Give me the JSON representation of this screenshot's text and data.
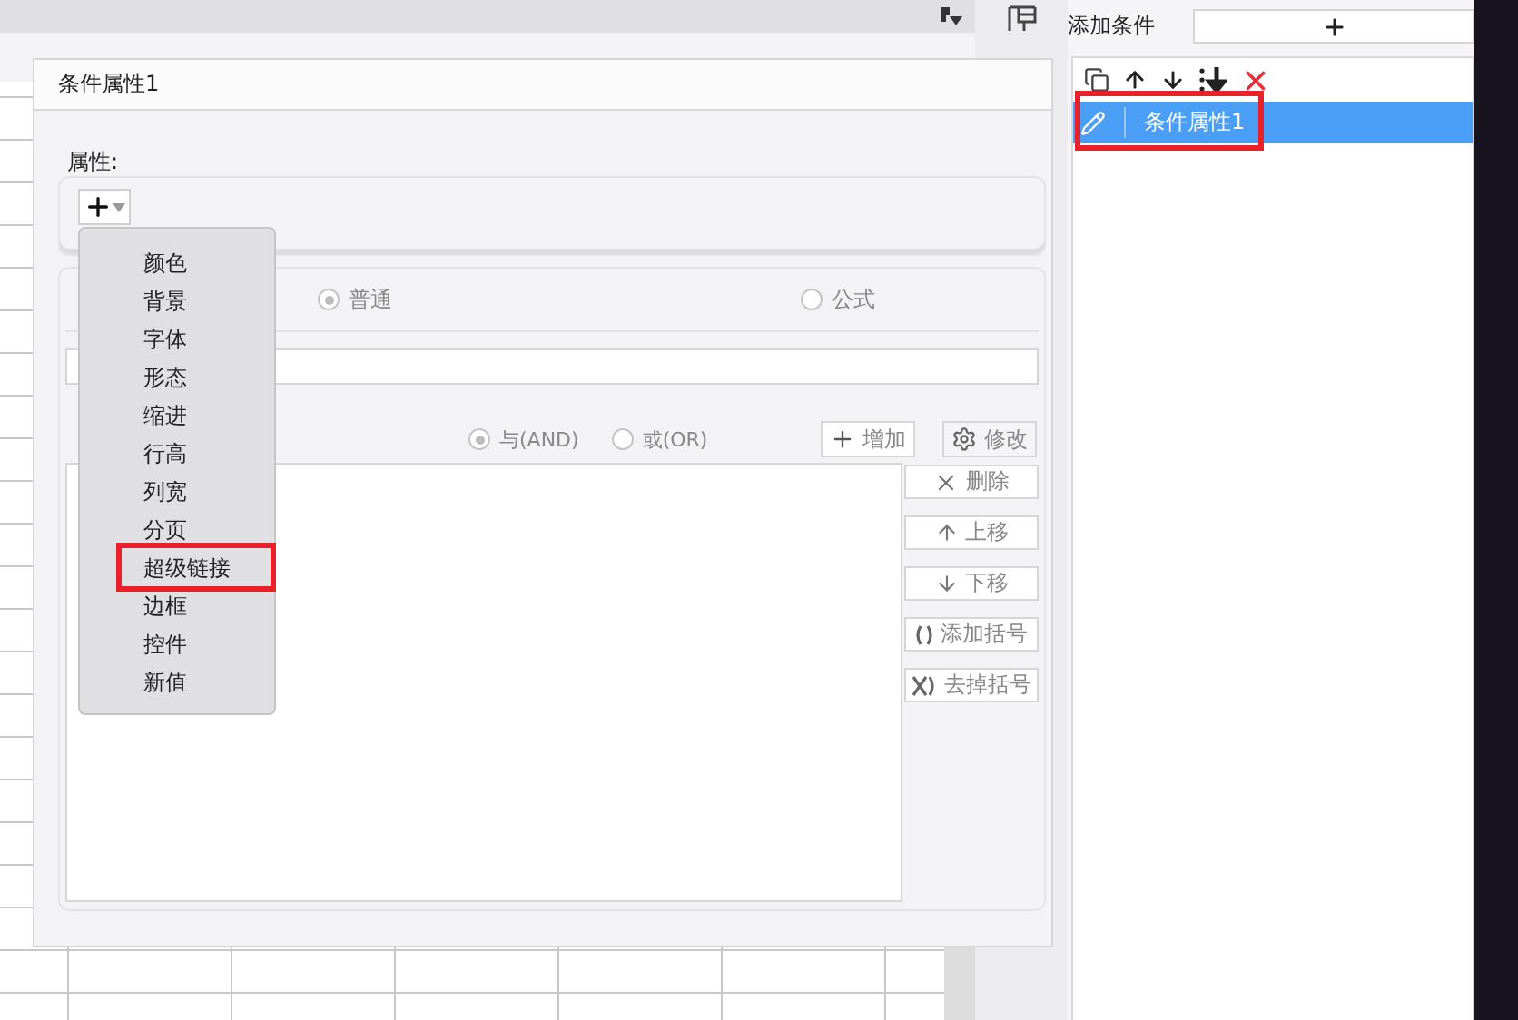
{
  "dialog": {
    "title": "条件属性1",
    "property_label": "属性:",
    "property_menu": [
      {
        "label": "颜色",
        "highlighted": false
      },
      {
        "label": "背景",
        "highlighted": false
      },
      {
        "label": "字体",
        "highlighted": false
      },
      {
        "label": "形态",
        "highlighted": false
      },
      {
        "label": "缩进",
        "highlighted": false
      },
      {
        "label": "行高",
        "highlighted": false
      },
      {
        "label": "列宽",
        "highlighted": false
      },
      {
        "label": "分页",
        "highlighted": false
      },
      {
        "label": "超级链接",
        "highlighted": true
      },
      {
        "label": "边框",
        "highlighted": false
      },
      {
        "label": "控件",
        "highlighted": false
      },
      {
        "label": "新值",
        "highlighted": false
      }
    ],
    "type_options": [
      {
        "label": "普通",
        "selected": true
      },
      {
        "label": "公式",
        "selected": false
      }
    ],
    "logic_options": [
      {
        "label": "与(AND)",
        "selected": true
      },
      {
        "label": "或(OR)",
        "selected": false
      }
    ],
    "top_buttons": [
      {
        "label": "增加",
        "kind": "plus"
      },
      {
        "label": "修改",
        "kind": "gear"
      }
    ],
    "side_buttons": [
      {
        "label": "删除",
        "kind": "x"
      },
      {
        "label": "上移",
        "kind": "up"
      },
      {
        "label": "下移",
        "kind": "down"
      },
      {
        "label": "添加括号",
        "kind": "paren"
      },
      {
        "label": "去掉括号",
        "kind": "unparen"
      }
    ]
  },
  "conditions_panel": {
    "add_label": "添加条件",
    "items": [
      {
        "label": "条件属性1",
        "selected": true,
        "highlighted": true
      }
    ]
  }
}
